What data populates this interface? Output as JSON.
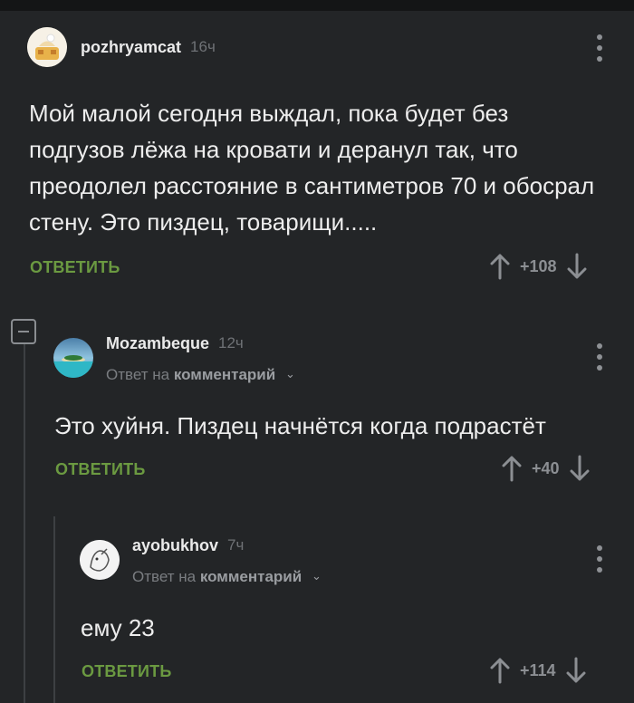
{
  "comments": [
    {
      "username": "pozhryamcat",
      "time": "16ч",
      "text": "Мой малой сегодня выждал, пока будет без подгузов лёжа на кровати и деранул так, что преодолел расстояние в сантиметров 70 и обосрал стену. Это пиздец, товарищи.....",
      "reply_label": "ОТВЕТИТЬ",
      "score": "+108"
    },
    {
      "username": "Mozambeque",
      "time": "12ч",
      "reply_prefix": "Ответ на",
      "reply_target": "комментарий",
      "text": "Это хуйня. Пиздец начнётся когда подрастёт",
      "reply_label": "ОТВЕТИТЬ",
      "score": "+40"
    },
    {
      "username": "ayobukhov",
      "time": "7ч",
      "reply_prefix": "Ответ на",
      "reply_target": "комментарий",
      "text": "ему 23",
      "reply_label": "ОТВЕТИТЬ",
      "score": "+114"
    }
  ],
  "icons": {
    "upvote": "arrow-up-icon",
    "downvote": "arrow-down-icon",
    "menu": "more-vertical-icon",
    "collapse": "minus-square-icon",
    "expand_reply": "chevron-down-icon"
  },
  "colors": {
    "background": "#232527",
    "reply_button": "#6b9a41",
    "thread_line": "#3d4043"
  }
}
